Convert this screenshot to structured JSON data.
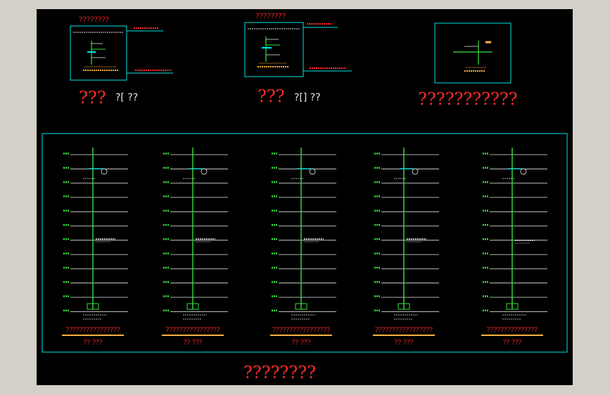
{
  "drawing": {
    "background": "#000000",
    "frame_color": "#d4d0c8",
    "cyan": "#00e5e5",
    "green": "#35e03a",
    "white": "#e8e8e8",
    "red": "#ff2a2a",
    "orange": "#ffb040"
  },
  "details": [
    {
      "heading": "????????",
      "caption_main": "???",
      "caption_sub": "?[ ??"
    },
    {
      "heading": "????????",
      "caption_main": "???",
      "caption_sub": "?[] ??"
    },
    {
      "heading": "",
      "caption_main": "???????????",
      "caption_sub": ""
    }
  ],
  "risers": [
    {
      "title": "????????????????",
      "sub": "?? ???"
    },
    {
      "title": "????????????????",
      "sub": "?? ???"
    },
    {
      "title": "?????????????????",
      "sub": "?? ???"
    },
    {
      "title": "?????????????????",
      "sub": "?? ???"
    },
    {
      "title": "???????????????",
      "sub": "?? ???"
    }
  ],
  "footer_title": "????????"
}
